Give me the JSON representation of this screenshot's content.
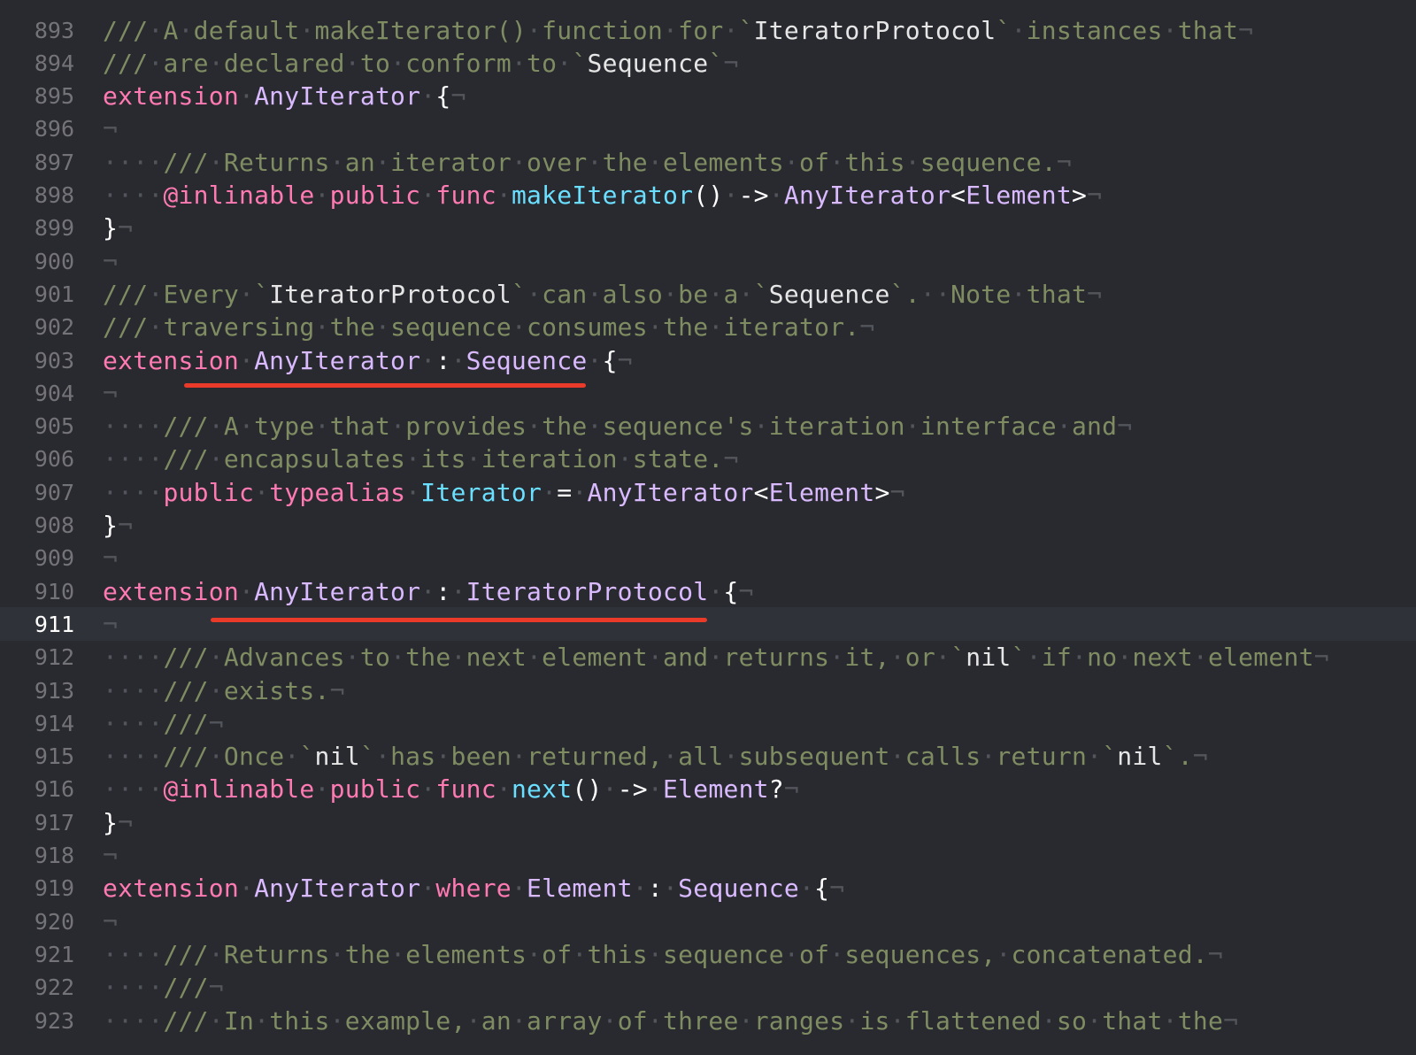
{
  "editor": {
    "language": "Swift",
    "current_line": "911",
    "colors": {
      "background": "#292a30",
      "comment": "#84b360",
      "keyword": "#ff7ab2",
      "type": "#dabaff",
      "function": "#6bdfff",
      "annotation_underline": "#e93a2a"
    },
    "lines": [
      {
        "n": "893",
        "tokens": [
          [
            "///·A·default·makeIterator()·function·for·`",
            "comment"
          ],
          [
            "IteratorProtocol",
            "codeintxt"
          ],
          [
            "`·instances·that",
            "comment"
          ],
          [
            "¬",
            "pilcrow"
          ]
        ]
      },
      {
        "n": "894",
        "tokens": [
          [
            "///·are·declared·to·conform·to·`",
            "comment"
          ],
          [
            "Sequence",
            "codeintxt"
          ],
          [
            "`",
            "comment"
          ],
          [
            "¬",
            "pilcrow"
          ]
        ]
      },
      {
        "n": "895",
        "tokens": [
          [
            "extension",
            "keyword"
          ],
          [
            "·",
            "ws"
          ],
          [
            "AnyIterator",
            "type"
          ],
          [
            "·",
            "ws"
          ],
          [
            "{",
            "plain"
          ],
          [
            "¬",
            "pilcrow"
          ]
        ]
      },
      {
        "n": "896",
        "tokens": [
          [
            "¬",
            "pilcrow"
          ]
        ]
      },
      {
        "n": "897",
        "tokens": [
          [
            "····",
            "ws"
          ],
          [
            "///·Returns·an·iterator·over·the·elements·of·this·sequence.",
            "comment"
          ],
          [
            "¬",
            "pilcrow"
          ]
        ]
      },
      {
        "n": "898",
        "tokens": [
          [
            "····",
            "ws"
          ],
          [
            "@inlinable",
            "keyword"
          ],
          [
            "·",
            "ws"
          ],
          [
            "public",
            "keyword"
          ],
          [
            "·",
            "ws"
          ],
          [
            "func",
            "keyword"
          ],
          [
            "·",
            "ws"
          ],
          [
            "makeIterator",
            "funcdecl"
          ],
          [
            "()·->·",
            "plain"
          ],
          [
            "AnyIterator",
            "type"
          ],
          [
            "<",
            "plain"
          ],
          [
            "Element",
            "type"
          ],
          [
            ">",
            "plain"
          ],
          [
            "¬",
            "pilcrow"
          ]
        ]
      },
      {
        "n": "899",
        "tokens": [
          [
            "}",
            "plain"
          ],
          [
            "¬",
            "pilcrow"
          ]
        ]
      },
      {
        "n": "900",
        "tokens": [
          [
            "¬",
            "pilcrow"
          ]
        ]
      },
      {
        "n": "901",
        "tokens": [
          [
            "///·Every·`",
            "comment"
          ],
          [
            "IteratorProtocol",
            "codeintxt"
          ],
          [
            "`·can·also·be·a·`",
            "comment"
          ],
          [
            "Sequence",
            "codeintxt"
          ],
          [
            "`.··Note·that",
            "comment"
          ],
          [
            "¬",
            "pilcrow"
          ]
        ]
      },
      {
        "n": "902",
        "tokens": [
          [
            "///·traversing·the·sequence·consumes·the·iterator.",
            "comment"
          ],
          [
            "¬",
            "pilcrow"
          ]
        ]
      },
      {
        "n": "903",
        "tokens": [
          [
            "extension",
            "keyword"
          ],
          [
            "·",
            "ws"
          ],
          [
            "AnyIterator",
            "type"
          ],
          [
            "·",
            "ws"
          ],
          [
            ":",
            "plain"
          ],
          [
            "·",
            "ws"
          ],
          [
            "Sequence",
            "type"
          ],
          [
            "·",
            "ws"
          ],
          [
            "{",
            "plain"
          ],
          [
            "¬",
            "pilcrow"
          ]
        ]
      },
      {
        "n": "904",
        "tokens": [
          [
            "¬",
            "pilcrow"
          ]
        ]
      },
      {
        "n": "905",
        "tokens": [
          [
            "····",
            "ws"
          ],
          [
            "///·A·type·that·provides·the·sequence's·iteration·interface·and",
            "comment"
          ],
          [
            "¬",
            "pilcrow"
          ]
        ]
      },
      {
        "n": "906",
        "tokens": [
          [
            "····",
            "ws"
          ],
          [
            "///·encapsulates·its·iteration·state.",
            "comment"
          ],
          [
            "¬",
            "pilcrow"
          ]
        ]
      },
      {
        "n": "907",
        "tokens": [
          [
            "····",
            "ws"
          ],
          [
            "public",
            "keyword"
          ],
          [
            "·",
            "ws"
          ],
          [
            "typealias",
            "keyword"
          ],
          [
            "·",
            "ws"
          ],
          [
            "Iterator",
            "funcdecl"
          ],
          [
            "·",
            "ws"
          ],
          [
            "=",
            "plain"
          ],
          [
            "·",
            "ws"
          ],
          [
            "AnyIterator",
            "type"
          ],
          [
            "<",
            "plain"
          ],
          [
            "Element",
            "type"
          ],
          [
            ">",
            "plain"
          ],
          [
            "¬",
            "pilcrow"
          ]
        ]
      },
      {
        "n": "908",
        "tokens": [
          [
            "}",
            "plain"
          ],
          [
            "¬",
            "pilcrow"
          ]
        ]
      },
      {
        "n": "909",
        "tokens": [
          [
            "¬",
            "pilcrow"
          ]
        ]
      },
      {
        "n": "910",
        "tokens": [
          [
            "extension",
            "keyword"
          ],
          [
            "·",
            "ws"
          ],
          [
            "AnyIterator",
            "type"
          ],
          [
            "·",
            "ws"
          ],
          [
            ":",
            "plain"
          ],
          [
            "·",
            "ws"
          ],
          [
            "IteratorProtocol",
            "type"
          ],
          [
            "·",
            "ws"
          ],
          [
            "{",
            "plain"
          ],
          [
            "¬",
            "pilcrow"
          ]
        ]
      },
      {
        "n": "911",
        "tokens": [
          [
            "¬",
            "pilcrow"
          ]
        ]
      },
      {
        "n": "912",
        "tokens": [
          [
            "····",
            "ws"
          ],
          [
            "///·Advances·to·the·next·element·and·returns·it,·or·`",
            "comment"
          ],
          [
            "nil",
            "codeintxt"
          ],
          [
            "`·if·no·next·element",
            "comment"
          ],
          [
            "¬",
            "pilcrow"
          ]
        ]
      },
      {
        "n": "913",
        "tokens": [
          [
            "····",
            "ws"
          ],
          [
            "///·exists.",
            "comment"
          ],
          [
            "¬",
            "pilcrow"
          ]
        ]
      },
      {
        "n": "914",
        "tokens": [
          [
            "····",
            "ws"
          ],
          [
            "///",
            "comment"
          ],
          [
            "¬",
            "pilcrow"
          ]
        ]
      },
      {
        "n": "915",
        "tokens": [
          [
            "····",
            "ws"
          ],
          [
            "///·Once·`",
            "comment"
          ],
          [
            "nil",
            "codeintxt"
          ],
          [
            "`·has·been·returned,·all·subsequent·calls·return·`",
            "comment"
          ],
          [
            "nil",
            "codeintxt"
          ],
          [
            "`.",
            "comment"
          ],
          [
            "¬",
            "pilcrow"
          ]
        ]
      },
      {
        "n": "916",
        "tokens": [
          [
            "····",
            "ws"
          ],
          [
            "@inlinable",
            "keyword"
          ],
          [
            "·",
            "ws"
          ],
          [
            "public",
            "keyword"
          ],
          [
            "·",
            "ws"
          ],
          [
            "func",
            "keyword"
          ],
          [
            "·",
            "ws"
          ],
          [
            "next",
            "funcdecl"
          ],
          [
            "()·->·",
            "plain"
          ],
          [
            "Element",
            "type"
          ],
          [
            "?",
            "plain"
          ],
          [
            "¬",
            "pilcrow"
          ]
        ]
      },
      {
        "n": "917",
        "tokens": [
          [
            "}",
            "plain"
          ],
          [
            "¬",
            "pilcrow"
          ]
        ]
      },
      {
        "n": "918",
        "tokens": [
          [
            "¬",
            "pilcrow"
          ]
        ]
      },
      {
        "n": "919",
        "tokens": [
          [
            "extension",
            "keyword"
          ],
          [
            "·",
            "ws"
          ],
          [
            "AnyIterator",
            "type"
          ],
          [
            "·",
            "ws"
          ],
          [
            "where",
            "keyword"
          ],
          [
            "·",
            "ws"
          ],
          [
            "Element",
            "type"
          ],
          [
            "·",
            "ws"
          ],
          [
            ":",
            "plain"
          ],
          [
            "·",
            "ws"
          ],
          [
            "Sequence",
            "type"
          ],
          [
            "·",
            "ws"
          ],
          [
            "{",
            "plain"
          ],
          [
            "¬",
            "pilcrow"
          ]
        ]
      },
      {
        "n": "920",
        "tokens": [
          [
            "¬",
            "pilcrow"
          ]
        ]
      },
      {
        "n": "921",
        "tokens": [
          [
            "····",
            "ws"
          ],
          [
            "///·Returns·the·elements·of·this·sequence·of·sequences,·concatenated.",
            "comment"
          ],
          [
            "¬",
            "pilcrow"
          ]
        ]
      },
      {
        "n": "922",
        "tokens": [
          [
            "····",
            "ws"
          ],
          [
            "///",
            "comment"
          ],
          [
            "¬",
            "pilcrow"
          ]
        ]
      },
      {
        "n": "923",
        "tokens": [
          [
            "····",
            "ws"
          ],
          [
            "///·In·this·example,·an·array·of·three·ranges·is·flattened·so·that·the",
            "comment"
          ],
          [
            "¬",
            "pilcrow"
          ]
        ]
      }
    ]
  }
}
